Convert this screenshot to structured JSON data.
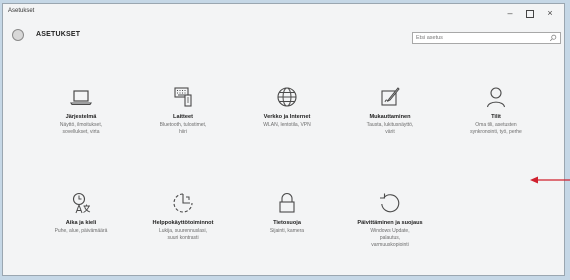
{
  "window": {
    "title": "Asetukset"
  },
  "controls": {
    "minimize": "–",
    "close": "×"
  },
  "header": {
    "title": "ASETUKSET",
    "search_placeholder": "Etsi asetus"
  },
  "tiles": [
    {
      "icon": "laptop-icon",
      "label": "Järjestelmä",
      "desc": [
        "Näyttö, ilmoitukset,",
        "sovellukset, virta"
      ]
    },
    {
      "icon": "keyboard-devices-icon",
      "label": "Laitteet",
      "desc": [
        "Bluetooth, tulostimet,",
        "hiiri"
      ]
    },
    {
      "icon": "globe-icon",
      "label": "Verkko ja Internet",
      "desc": [
        "WLAN, lentotila, VPN"
      ]
    },
    {
      "icon": "paint-brush-icon",
      "label": "Mukauttaminen",
      "desc": [
        "Tausta, lukitusnäyttö,",
        "värit"
      ]
    },
    {
      "icon": "person-icon",
      "label": "Tilit",
      "desc": [
        "Oma tili, asetusten",
        "synkronointi, työ, perhe"
      ]
    },
    {
      "icon": "clock-language-icon",
      "label": "Aika ja kieli",
      "desc": [
        "Puhe, alue, päivämäärä"
      ]
    },
    {
      "icon": "ease-of-access-icon",
      "label": "Helppokäyttötoiminnot",
      "desc": [
        "Lukija, suurennuslasi,",
        "suuri kontrasti"
      ]
    },
    {
      "icon": "lock-icon",
      "label": "Tietosuoja",
      "desc": [
        "Sijainti, kamera"
      ]
    },
    {
      "icon": "update-icon",
      "label": "Päivittäminen ja suojaus",
      "desc": [
        "Windows Update,",
        "palautus,",
        "varmuuskopiointi"
      ]
    }
  ],
  "colors": {
    "icon": "#4a4a4a",
    "arrow": "#d0202e",
    "desktop": "#c5d7e6"
  }
}
